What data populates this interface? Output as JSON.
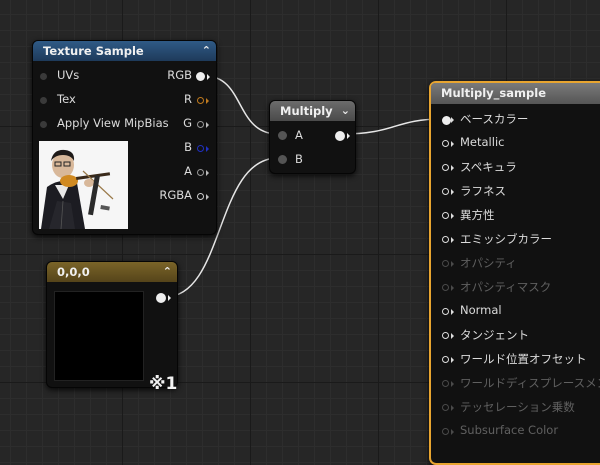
{
  "texture_node": {
    "title": "Texture Sample",
    "pins_in": [
      "UVs",
      "Tex",
      "Apply View MipBias"
    ],
    "pins_out": [
      "RGB",
      "R",
      "G",
      "B",
      "A",
      "RGBA"
    ],
    "header_color": "#2a4a6e"
  },
  "multiply_node": {
    "title": "Multiply",
    "pins_in": [
      "A",
      "B"
    ],
    "header_color": "#5a5a5a"
  },
  "constant_node": {
    "title": "0,0,0",
    "header_color": "#6e5a20",
    "swatch_color": "#000000"
  },
  "material_node": {
    "title": "Multiply_sample",
    "accent_color": "#e8a530",
    "pins": [
      {
        "label": "ベースカラー",
        "active": true
      },
      {
        "label": "Metallic",
        "active": true
      },
      {
        "label": "スペキュラ",
        "active": true
      },
      {
        "label": "ラフネス",
        "active": true
      },
      {
        "label": "異方性",
        "active": true
      },
      {
        "label": "エミッシブカラー",
        "active": true
      },
      {
        "label": "オパシティ",
        "active": false
      },
      {
        "label": "オパシティマスク",
        "active": false
      },
      {
        "label": "Normal",
        "active": true
      },
      {
        "label": "タンジェント",
        "active": true
      },
      {
        "label": "ワールド位置オフセット",
        "active": true
      },
      {
        "label": "ワールドディスプレースメント",
        "active": false
      },
      {
        "label": "テッセレーション乗数",
        "active": false
      },
      {
        "label": "Subsurface Color",
        "active": false
      }
    ]
  },
  "annotation": "※1"
}
